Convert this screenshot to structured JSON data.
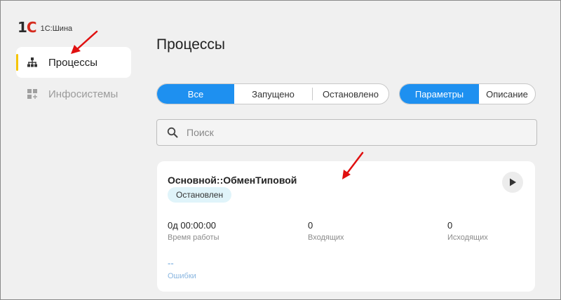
{
  "brand": {
    "mark_main": "1",
    "mark_accent": "С",
    "name": "1С:Шина"
  },
  "sidebar": {
    "items": [
      {
        "label": "Процессы",
        "icon": "sitemap-icon",
        "active": true
      },
      {
        "label": "Инфосистемы",
        "icon": "grid-plus-icon",
        "active": false
      }
    ]
  },
  "main": {
    "title": "Процессы",
    "filter_tabs": [
      "Все",
      "Запущено",
      "Остановлено"
    ],
    "filter_selected": "Все",
    "view_tabs": [
      "Параметры",
      "Описание"
    ],
    "view_selected": "Параметры",
    "search": {
      "placeholder": "Поиск",
      "value": ""
    },
    "process_card": {
      "name": "Основной::ОбменТиповой",
      "status": "Остановлен",
      "stats": [
        {
          "value": "0д 00:00:00",
          "label": "Время работы"
        },
        {
          "value": "0",
          "label": "Входящих"
        },
        {
          "value": "0",
          "label": "Исходящих"
        }
      ],
      "errors": {
        "value": "--",
        "label": "Ошибки"
      }
    }
  },
  "colors": {
    "accent": "#1e90f0",
    "active_marker": "#f5c400",
    "badge_bg": "#e0f4fa",
    "annotation_arrow": "#e01010"
  }
}
